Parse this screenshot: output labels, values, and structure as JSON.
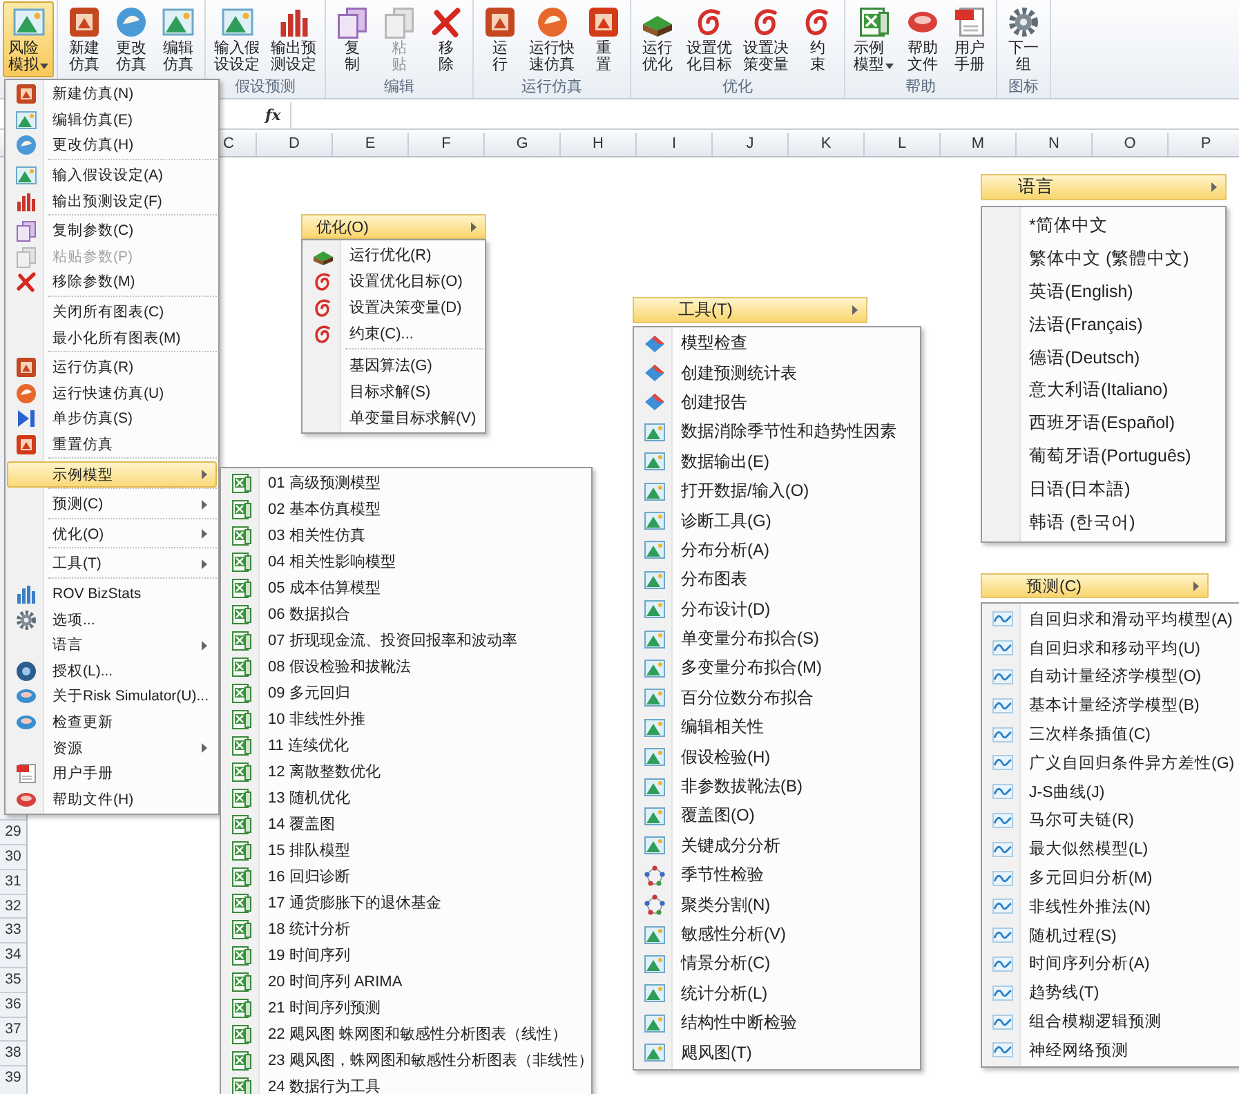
{
  "ribbon": {
    "groups": [
      {
        "buttons": [
          {
            "label": "风险模拟",
            "dropdown": true,
            "active": true,
            "disabled": false
          }
        ]
      },
      {
        "buttons": [
          {
            "label": "新建仿真",
            "dropdown": false,
            "active": false,
            "disabled": false
          },
          {
            "label": "更改仿真",
            "dropdown": false,
            "active": false,
            "disabled": false
          },
          {
            "label": "编辑仿真",
            "dropdown": false,
            "active": false,
            "disabled": false
          }
        ]
      },
      {
        "label": "假设预测",
        "buttons": [
          {
            "label": "输入假设设定",
            "dropdown": false,
            "active": false,
            "disabled": false
          },
          {
            "label": "输出预测设定",
            "dropdown": false,
            "active": false,
            "disabled": false
          }
        ]
      },
      {
        "label": "编辑",
        "buttons": [
          {
            "label": "复制",
            "dropdown": false,
            "active": false,
            "disabled": false
          },
          {
            "label": "粘贴",
            "dropdown": false,
            "active": false,
            "disabled": true
          },
          {
            "label": "移除",
            "dropdown": false,
            "active": false,
            "disabled": false
          }
        ]
      },
      {
        "label": "运行仿真",
        "buttons": [
          {
            "label": "运行",
            "dropdown": false,
            "active": false,
            "disabled": false
          },
          {
            "label": "运行快速仿真",
            "dropdown": false,
            "active": false,
            "disabled": false
          },
          {
            "label": "重置",
            "dropdown": false,
            "active": false,
            "disabled": false
          }
        ]
      },
      {
        "label": "优化",
        "buttons": [
          {
            "label": "运行优化",
            "dropdown": false,
            "active": false,
            "disabled": false
          },
          {
            "label": "设置优化目标",
            "dropdown": false,
            "active": false,
            "disabled": false
          },
          {
            "label": "设置决策变量",
            "dropdown": false,
            "active": false,
            "disabled": false
          },
          {
            "label": "约束",
            "dropdown": false,
            "active": false,
            "disabled": false
          }
        ]
      },
      {
        "label": "帮助",
        "buttons": [
          {
            "label": "示例模型",
            "dropdown": true,
            "active": false,
            "disabled": false
          },
          {
            "label": "帮助文件",
            "dropdown": false,
            "active": false,
            "disabled": false
          },
          {
            "label": "用户手册",
            "dropdown": false,
            "active": false,
            "disabled": false
          }
        ]
      },
      {
        "label": "图标",
        "buttons": [
          {
            "label": "下一组",
            "dropdown": false,
            "active": false,
            "disabled": false
          }
        ]
      }
    ]
  },
  "formula_bar": {
    "fx": "fx"
  },
  "columns": [
    "C",
    "D",
    "E",
    "F",
    "G",
    "H",
    "I",
    "J",
    "K",
    "L",
    "M",
    "N",
    "O",
    "P"
  ],
  "rows": [
    "29",
    "30",
    "31",
    "32",
    "33",
    "34",
    "35",
    "36",
    "37",
    "38",
    "39"
  ],
  "main_menu": {
    "sections": [
      [
        {
          "label": "新建仿真(N)",
          "submenu": false,
          "disabled": false,
          "selected": false
        },
        {
          "label": "编辑仿真(E)",
          "submenu": false,
          "disabled": false,
          "selected": false
        },
        {
          "label": "更改仿真(H)",
          "submenu": false,
          "disabled": false,
          "selected": false
        }
      ],
      [
        {
          "label": "输入假设设定(A)",
          "submenu": false,
          "disabled": false,
          "selected": false
        },
        {
          "label": "输出预测设定(F)",
          "submenu": false,
          "disabled": false,
          "selected": false
        }
      ],
      [
        {
          "label": "复制参数(C)",
          "submenu": false,
          "disabled": false,
          "selected": false
        },
        {
          "label": "粘贴参数(P)",
          "submenu": false,
          "disabled": true,
          "selected": false
        },
        {
          "label": "移除参数(M)",
          "submenu": false,
          "disabled": false,
          "selected": false
        }
      ],
      [
        {
          "label": "关闭所有图表(C)",
          "submenu": false,
          "disabled": false,
          "selected": false
        },
        {
          "label": "最小化所有图表(M)",
          "submenu": false,
          "disabled": false,
          "selected": false
        }
      ],
      [
        {
          "label": "运行仿真(R)",
          "submenu": false,
          "disabled": false,
          "selected": false
        },
        {
          "label": "运行快速仿真(U)",
          "submenu": false,
          "disabled": false,
          "selected": false
        },
        {
          "label": "单步仿真(S)",
          "submenu": false,
          "disabled": false,
          "selected": false
        },
        {
          "label": "重置仿真",
          "submenu": false,
          "disabled": false,
          "selected": false
        }
      ],
      [
        {
          "label": "示例模型",
          "submenu": true,
          "disabled": false,
          "selected": true
        }
      ],
      [
        {
          "label": "预测(C)",
          "submenu": true,
          "disabled": false,
          "selected": false
        }
      ],
      [
        {
          "label": "优化(O)",
          "submenu": true,
          "disabled": false,
          "selected": false
        }
      ],
      [
        {
          "label": "工具(T)",
          "submenu": true,
          "disabled": false,
          "selected": false
        }
      ],
      [
        {
          "label": "ROV BizStats",
          "submenu": false,
          "disabled": false,
          "selected": false
        },
        {
          "label": "选项...",
          "submenu": false,
          "disabled": false,
          "selected": false
        },
        {
          "label": "语言",
          "submenu": true,
          "disabled": false,
          "selected": false
        },
        {
          "label": "授权(L)...",
          "submenu": false,
          "disabled": false,
          "selected": false
        },
        {
          "label": "关于Risk Simulator(U)...",
          "submenu": false,
          "disabled": false,
          "selected": false
        },
        {
          "label": "检查更新",
          "submenu": false,
          "disabled": false,
          "selected": false
        },
        {
          "label": "资源",
          "submenu": true,
          "disabled": false,
          "selected": false
        },
        {
          "label": "用户手册",
          "submenu": false,
          "disabled": false,
          "selected": false
        },
        {
          "label": "帮助文件(H)",
          "submenu": false,
          "disabled": false,
          "selected": false
        }
      ]
    ]
  },
  "examples_menu": {
    "items": [
      "01 高级预测模型",
      "02 基本仿真模型",
      "03 相关性仿真",
      "04 相关性影响模型",
      "05 成本估算模型",
      "06 数据拟合",
      "07 折现现金流、投资回报率和波动率",
      "08 假设检验和拔靴法",
      "09 多元回归",
      "10 非线性外推",
      "11 连续优化",
      "12 离散整数优化",
      "13 随机优化",
      "14 覆盖图",
      "15 排队模型",
      "16 回归诊断",
      "17 通货膨胀下的退休基金",
      "18 统计分析",
      "19 时间序列",
      "20 时间序列 ARIMA",
      "21 时间序列预测",
      "22 飓风图 蛛网图和敏感性分析图表（线性）",
      "23 飓风图，蛛网图和敏感性分析图表（非线性）",
      "24 数据行为工具"
    ]
  },
  "optimize_menu": {
    "header": "优化(O)",
    "sections": [
      [
        "运行优化(R)",
        "设置优化目标(O)",
        "设置决策变量(D)",
        "约束(C)..."
      ],
      [
        "基因算法(G)",
        "目标求解(S)",
        "单变量目标求解(V)"
      ]
    ]
  },
  "tools_menu": {
    "header": "工具(T)",
    "items": [
      "模型检查",
      "创建预测统计表",
      "创建报告",
      "数据消除季节性和趋势性因素",
      "数据输出(E)",
      "打开数据/输入(O)",
      "诊断工具(G)",
      "分布分析(A)",
      "分布图表",
      "分布设计(D)",
      "单变量分布拟合(S)",
      "多变量分布拟合(M)",
      "百分位数分布拟合",
      "编辑相关性",
      "假设检验(H)",
      "非参数拔靴法(B)",
      "覆盖图(O)",
      "关键成分分析",
      "季节性检验",
      "聚类分割(N)",
      "敏感性分析(V)",
      "情景分析(C)",
      "统计分析(L)",
      "结构性中断检验",
      "飓风图(T)"
    ]
  },
  "language_menu": {
    "header": "语言",
    "items": [
      "*简体中文",
      "繁体中文 (繁體中文)",
      "英语(English)",
      "法语(Français)",
      "德语(Deutsch)",
      "意大利语(Italiano)",
      "西班牙语(Español)",
      "葡萄牙语(Português)",
      "日语(日本語)",
      "韩语 (한국어)"
    ]
  },
  "forecast_menu": {
    "header": "预测(C)",
    "items": [
      "自回归求和滑动平均模型(A)",
      "自回归求和移动平均(U)",
      "自动计量经济学模型(O)",
      "基本计量经济学模型(B)",
      "三次样条插值(C)",
      "广义自回归条件异方差性(G)",
      "J-S曲线(J)",
      "马尔可夫链(R)",
      "最大似然模型(L)",
      "多元回归分析(M)",
      "非线性外推法(N)",
      "随机过程(S)",
      "时间序列分析(A)",
      "趋势线(T)",
      "组合模糊逻辑预测",
      "神经网络预测"
    ]
  }
}
